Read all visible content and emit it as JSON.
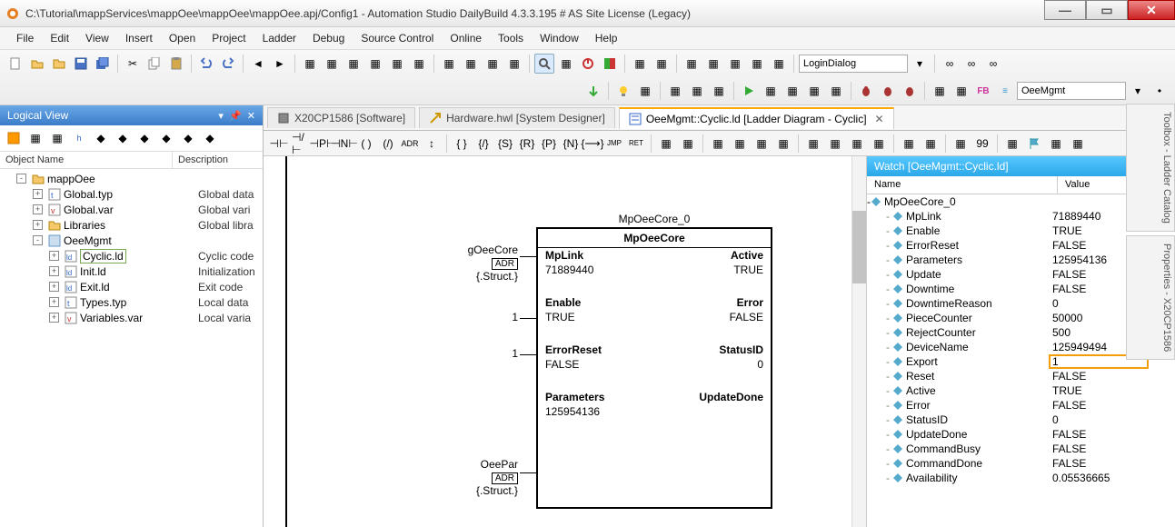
{
  "title": "C:\\Tutorial\\mappServices\\mappOee\\mappOee\\mappOee.apj/Config1 - Automation Studio DailyBuild 4.3.3.195 # AS Site License (Legacy)",
  "menu": [
    "File",
    "Edit",
    "View",
    "Insert",
    "Open",
    "Project",
    "Ladder",
    "Debug",
    "Source Control",
    "Online",
    "Tools",
    "Window",
    "Help"
  ],
  "combo1": "LoginDialog",
  "combo2": "OeeMgmt",
  "logicalView": {
    "title": "Logical View",
    "cols": [
      "Object Name",
      "Description"
    ],
    "rows": [
      {
        "ind": 0,
        "tg": "-",
        "icon": "folder",
        "name": "mappOee",
        "desc": ""
      },
      {
        "ind": 1,
        "tg": "+",
        "icon": "typ",
        "name": "Global.typ",
        "desc": "Global data"
      },
      {
        "ind": 1,
        "tg": "+",
        "icon": "var",
        "name": "Global.var",
        "desc": "Global vari"
      },
      {
        "ind": 1,
        "tg": "+",
        "icon": "folder",
        "name": "Libraries",
        "desc": "Global libra"
      },
      {
        "ind": 1,
        "tg": "-",
        "icon": "prg",
        "name": "OeeMgmt",
        "desc": ""
      },
      {
        "ind": 2,
        "tg": "+",
        "icon": "ld",
        "name": "Cyclic.ld",
        "desc": "Cyclic code",
        "selected": true
      },
      {
        "ind": 2,
        "tg": "+",
        "icon": "ld",
        "name": "Init.ld",
        "desc": "Initialization"
      },
      {
        "ind": 2,
        "tg": "+",
        "icon": "ld",
        "name": "Exit.ld",
        "desc": "Exit code"
      },
      {
        "ind": 2,
        "tg": "+",
        "icon": "typ",
        "name": "Types.typ",
        "desc": "Local data"
      },
      {
        "ind": 2,
        "tg": "+",
        "icon": "var",
        "name": "Variables.var",
        "desc": "Local varia"
      }
    ]
  },
  "tabs": [
    {
      "label": "X20CP1586 [Software]",
      "icon": "cpu"
    },
    {
      "label": "Hardware.hwl [System Designer]",
      "icon": "hw"
    },
    {
      "label": "OeeMgmt::Cyclic.ld [Ladder Diagram - Cyclic]",
      "icon": "ld",
      "active": true,
      "close": true
    }
  ],
  "fb": {
    "instance": "MpOeeCore_0",
    "type": "MpOeeCore",
    "left_in": {
      "name": "gOeeCore",
      "attr": "ADR",
      "struct": "{.Struct.}"
    },
    "left_in2": {
      "name": "OeePar",
      "attr": "ADR",
      "struct": "{.Struct.}"
    },
    "rows": [
      {
        "l": "MpLink",
        "r": "Active"
      },
      {
        "l": "71889440",
        "r": "TRUE"
      },
      {
        "sep": true
      },
      {
        "wl": "1"
      },
      {
        "l": "Enable",
        "r": "Error"
      },
      {
        "l": "TRUE",
        "r": "FALSE"
      },
      {
        "wl": "1"
      },
      {
        "sep": true
      },
      {
        "l": "ErrorReset",
        "r": "StatusID"
      },
      {
        "l": "FALSE",
        "r": "0"
      },
      {
        "sep": true
      },
      {
        "l": "Parameters",
        "r": "UpdateDone"
      },
      {
        "l": "125954136",
        "r": ""
      }
    ]
  },
  "watch": {
    "title": "Watch [OeeMgmt::Cyclic.ld]",
    "cols": [
      "Name",
      "Value"
    ],
    "root": "MpOeeCore_0",
    "items": [
      {
        "n": "MpLink",
        "v": "71889440"
      },
      {
        "n": "Enable",
        "v": "TRUE"
      },
      {
        "n": "ErrorReset",
        "v": "FALSE"
      },
      {
        "n": "Parameters",
        "v": "125954136"
      },
      {
        "n": "Update",
        "v": "FALSE"
      },
      {
        "n": "Downtime",
        "v": "FALSE"
      },
      {
        "n": "DowntimeReason",
        "v": "0"
      },
      {
        "n": "PieceCounter",
        "v": "50000"
      },
      {
        "n": "RejectCounter",
        "v": "500"
      },
      {
        "n": "DeviceName",
        "v": "125949494"
      },
      {
        "n": "Export",
        "v": "1",
        "edit": true
      },
      {
        "n": "Reset",
        "v": "FALSE"
      },
      {
        "n": "Active",
        "v": "TRUE"
      },
      {
        "n": "Error",
        "v": "FALSE"
      },
      {
        "n": "StatusID",
        "v": "0"
      },
      {
        "n": "UpdateDone",
        "v": "FALSE"
      },
      {
        "n": "CommandBusy",
        "v": "FALSE"
      },
      {
        "n": "CommandDone",
        "v": "FALSE"
      },
      {
        "n": "Availability",
        "v": "0.05536665"
      }
    ]
  },
  "sidetabs": [
    "Toolbox - Ladder Catalog",
    "Properties - X20CP1586"
  ]
}
